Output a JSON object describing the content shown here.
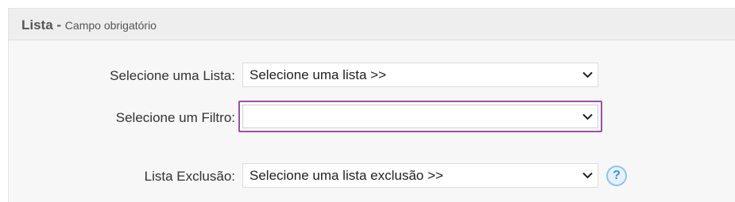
{
  "header": {
    "title": "Lista -",
    "subtitle": "Campo obrigatório"
  },
  "form": {
    "lista": {
      "label": "Selecione uma Lista:",
      "value": "Selecione uma lista >>"
    },
    "filtro": {
      "label": "Selecione um Filtro:",
      "value": ""
    },
    "exclusao": {
      "label": "Lista Exclusão:",
      "value": "Selecione uma lista exclusão >>"
    }
  },
  "icons": {
    "dropdown": "chevron-down-icon",
    "help": "question-mark-icon",
    "help_glyph": "?"
  },
  "colors": {
    "focus_border": "#9d4da9",
    "help_blue": "#3e94d8"
  }
}
